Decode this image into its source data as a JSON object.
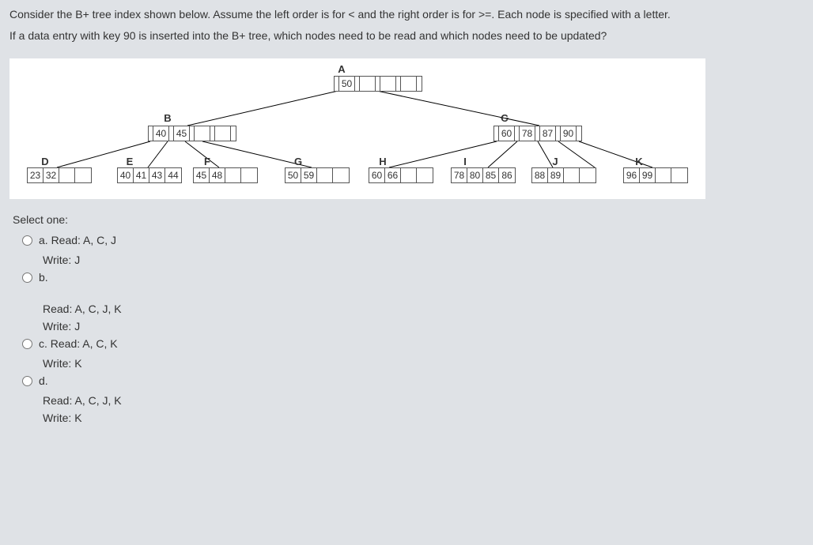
{
  "question": {
    "line1": "Consider the B+ tree index shown below. Assume the left order is for < and the right order is for >=. Each node is specified with a letter.",
    "line2": "If a data entry with key 90 is inserted into the B+ tree, which nodes need to be read and which nodes need to be updated?"
  },
  "tree": {
    "nodes": {
      "A": {
        "label": "A",
        "keys": [
          "50",
          "",
          "",
          "",
          ""
        ]
      },
      "B": {
        "label": "B",
        "keys": [
          "40",
          "45",
          "",
          "",
          ""
        ]
      },
      "C": {
        "label": "C",
        "keys": [
          "60",
          "78",
          "87",
          "90"
        ]
      },
      "D": {
        "label": "D",
        "keys": [
          "23",
          "32",
          "",
          ""
        ]
      },
      "E": {
        "label": "E",
        "keys": [
          "40",
          "41",
          "43",
          "44"
        ]
      },
      "F": {
        "label": "F",
        "keys": [
          "45",
          "48",
          "",
          ""
        ]
      },
      "G": {
        "label": "G",
        "keys": [
          "50",
          "59",
          "",
          ""
        ]
      },
      "H": {
        "label": "H",
        "keys": [
          "60",
          "66",
          "",
          ""
        ]
      },
      "I": {
        "label": "I",
        "keys": [
          "78",
          "80",
          "85",
          "86"
        ]
      },
      "J": {
        "label": "J",
        "keys": [
          "88",
          "89",
          "",
          ""
        ]
      },
      "K": {
        "label": "K",
        "keys": [
          "96",
          "99",
          "",
          ""
        ]
      }
    }
  },
  "answers": {
    "prompt": "Select one:",
    "a": {
      "label": "a. Read: A, C, J",
      "sub": "Write: J"
    },
    "b": {
      "label": "b.",
      "sub1": "Read: A, C, J, K",
      "sub2": "Write: J"
    },
    "c": {
      "label": "c. Read: A, C, K",
      "sub": "Write: K"
    },
    "d": {
      "label": "d.",
      "sub1": "Read: A, C, J, K",
      "sub2": "Write: K"
    }
  }
}
